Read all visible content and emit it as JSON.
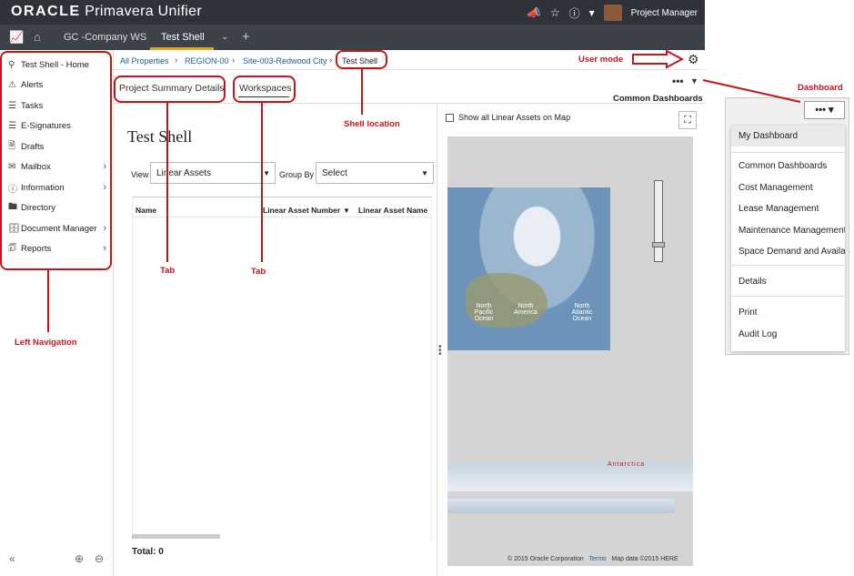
{
  "topbar": {
    "brand_strong": "ORACLE",
    "brand_rest": " Primavera Unifier",
    "user_role": "Project Manager",
    "icons": [
      "megaphone-icon",
      "star-icon",
      "help-icon",
      "chevron-down-icon",
      "avatar"
    ]
  },
  "tabbar": {
    "tabs": [
      {
        "label": "GC -Company WS",
        "active": false
      },
      {
        "label": "Test Shell",
        "active": true
      }
    ],
    "icons": [
      "chart-icon",
      "home-icon",
      "chevron-down-icon",
      "plus-icon"
    ],
    "accent_color": "#e8a317"
  },
  "leftnav": {
    "items": [
      {
        "label": "Test Shell - Home",
        "icon": "shell-home-icon",
        "has_children": false,
        "selected": true
      },
      {
        "label": "Alerts",
        "icon": "alert-icon",
        "has_children": false
      },
      {
        "label": "Tasks",
        "icon": "tasks-icon",
        "has_children": false
      },
      {
        "label": "E-Signatures",
        "icon": "esignature-icon",
        "has_children": false
      },
      {
        "label": "Drafts",
        "icon": "drafts-icon",
        "has_children": false
      },
      {
        "label": "Mailbox",
        "icon": "mail-icon",
        "has_children": true
      },
      {
        "label": "Information",
        "icon": "info-icon",
        "has_children": true
      },
      {
        "label": "Directory",
        "icon": "folder-icon",
        "has_children": false
      },
      {
        "label": "Document Manager",
        "icon": "document-icon",
        "has_children": true
      },
      {
        "label": "Reports",
        "icon": "reports-icon",
        "has_children": true
      }
    ],
    "bottom": [
      "collapse-icon",
      "zoom-in-icon",
      "zoom-out-icon"
    ]
  },
  "breadcrumb": [
    "All Properties",
    "REGION-00",
    "Site-003-Redwood City",
    "Test Shell"
  ],
  "subtabs": [
    "Project Summary Details",
    "Workspaces"
  ],
  "main": {
    "title": "Test Shell",
    "view_label": "View",
    "view_value": "Linear Assets",
    "group_label": "Group By",
    "group_value": "Select",
    "columns": [
      "Name",
      "Linear Asset Number",
      "Linear Asset Name"
    ],
    "total_label": "Total: 0"
  },
  "map": {
    "checkbox_label": "Show all Linear Assets on Map",
    "labels": [
      "North Pacific Ocean",
      "North America",
      "North Atlantic Ocean",
      "Antarctica"
    ],
    "footer": {
      "copyright": "© 2015 Oracle Corporation",
      "terms": "Terms",
      "data": "Map data ©2015 HERE"
    }
  },
  "dashboard": {
    "header": "Common Dashboards",
    "more_label": "•••",
    "menu": [
      {
        "label": "My Dashboard",
        "group": 1,
        "selected": true
      },
      {
        "label": "Common Dashboards",
        "group": 2
      },
      {
        "label": "Cost Management",
        "group": 2
      },
      {
        "label": "Lease Management",
        "group": 2
      },
      {
        "label": "Maintenance Management",
        "group": 2
      },
      {
        "label": "Space Demand and Availability",
        "group": 2
      },
      {
        "label": "Details",
        "group": 3
      },
      {
        "label": "Print",
        "group": 4
      },
      {
        "label": "Audit Log",
        "group": 4
      }
    ]
  },
  "annotations": {
    "user_mode": "User mode",
    "dashboard": "Dashboard",
    "shell_location": "Shell location",
    "tab1": "Tab",
    "tab2": "Tab",
    "left_navigation": "Left Navigation",
    "color": "#c0171d"
  }
}
